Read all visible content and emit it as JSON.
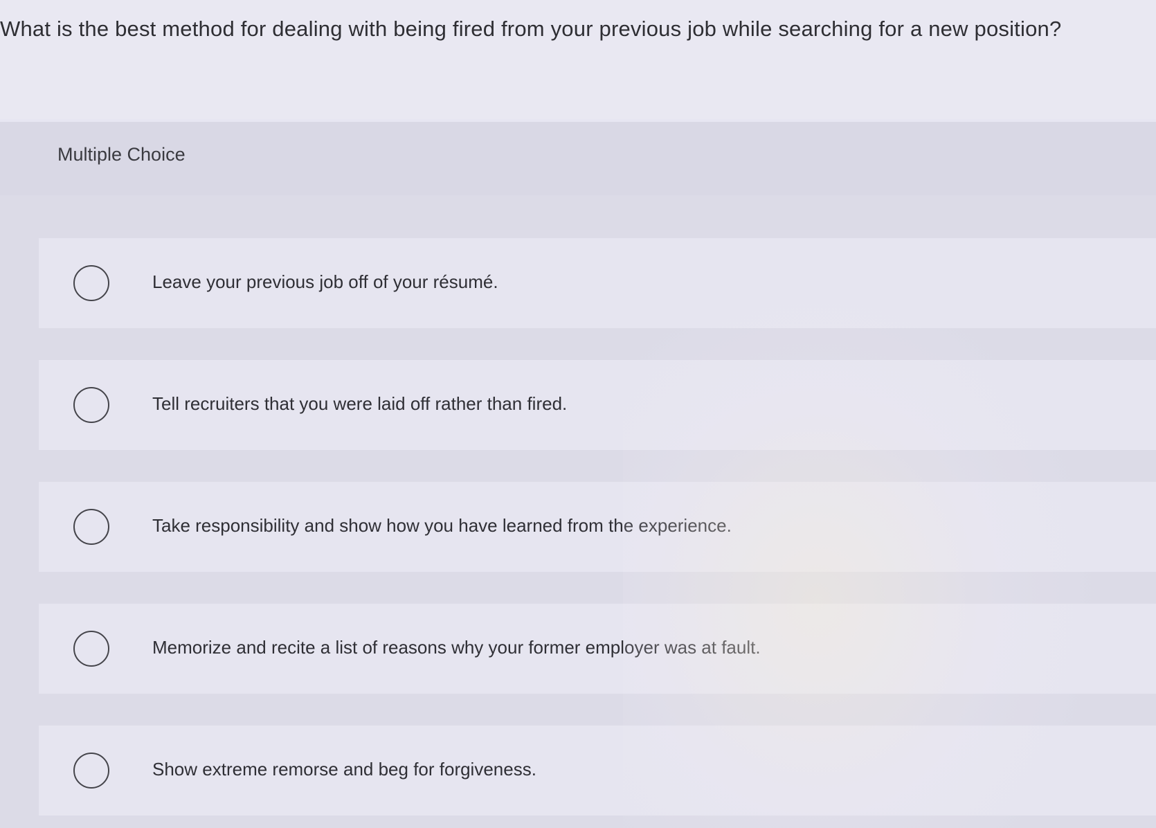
{
  "question": {
    "text": "What is the best method for dealing with being fired from your previous job while searching for a new position?"
  },
  "question_type": {
    "label": "Multiple Choice"
  },
  "choices": [
    {
      "label": "Leave your previous job off of your résumé."
    },
    {
      "label": "Tell recruiters that you were laid off rather than fired."
    },
    {
      "label": "Take responsibility and show how you have learned from the experience."
    },
    {
      "label": "Memorize and recite a list of reasons why your former employer was at fault."
    },
    {
      "label": "Show extreme remorse and beg for forgiveness."
    }
  ],
  "colors": {
    "background": "#e7e6f1",
    "header_band": "#d9d8e5",
    "choice_card": "#e6e5f0",
    "text": "#2f2f35"
  }
}
